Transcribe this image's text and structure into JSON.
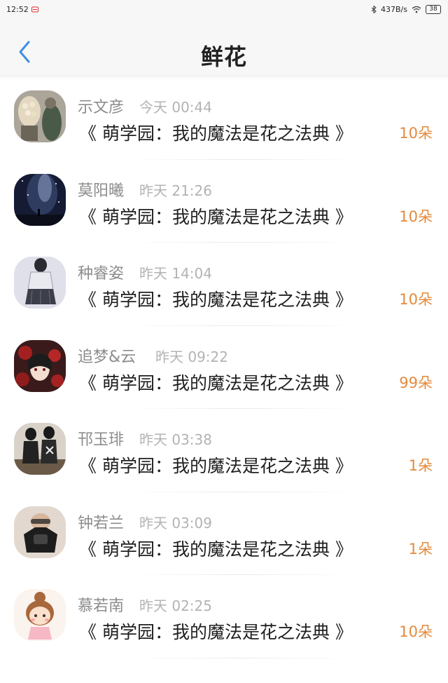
{
  "status_bar": {
    "time": "12:52",
    "net_speed": "437B/s",
    "battery": "38",
    "icons": [
      "notification-icon",
      "bluetooth-icon",
      "wifi-icon",
      "battery-icon"
    ]
  },
  "header": {
    "title": "鲜花",
    "back_icon": "chevron-left-icon"
  },
  "colors": {
    "accent": "#3d8fe0",
    "count": "#e58a3c",
    "name": "#8c8c8c",
    "time": "#b3b3b3"
  },
  "items": [
    {
      "name": "示文彦",
      "time": "今天 00:44",
      "book": "《 萌学园：我的魔法是花之法典 》",
      "count": "10朵"
    },
    {
      "name": "莫阳曦",
      "time": "昨天 21:26",
      "book": "《 萌学园：我的魔法是花之法典 》",
      "count": "10朵"
    },
    {
      "name": "种睿姿",
      "time": "昨天 14:04",
      "book": "《 萌学园：我的魔法是花之法典 》",
      "count": "10朵"
    },
    {
      "name": "追梦&云",
      "time": "昨天 09:22",
      "book": "《 萌学园：我的魔法是花之法典 》",
      "count": "99朵"
    },
    {
      "name": "邗玉琲",
      "time": "昨天 03:38",
      "book": "《 萌学园：我的魔法是花之法典 》",
      "count": "1朵"
    },
    {
      "name": "钟若兰",
      "time": "昨天 03:09",
      "book": "《 萌学园：我的魔法是花之法典 》",
      "count": "1朵"
    },
    {
      "name": "慕若南",
      "time": "昨天 02:25",
      "book": "《 萌学园：我的魔法是花之法典 》",
      "count": "10朵"
    }
  ]
}
